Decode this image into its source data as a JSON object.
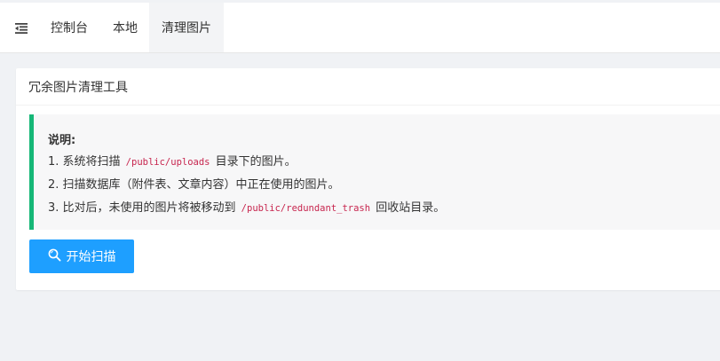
{
  "nav": {
    "toggle_icon": "menu-fold-icon",
    "tabs": [
      {
        "label": "控制台",
        "active": false
      },
      {
        "label": "本地",
        "active": false
      },
      {
        "label": "清理图片",
        "active": true
      }
    ]
  },
  "card": {
    "title": "冗余图片清理工具",
    "notice": {
      "title": "说明:",
      "line1_pre": "1. 系统将扫描 ",
      "line1_code": "/public/uploads",
      "line1_post": " 目录下的图片。",
      "line2": "2. 扫描数据库（附件表、文章内容）中正在使用的图片。",
      "line3_pre": "3. 比对后，未使用的图片将被移动到 ",
      "line3_code": "/public/redundant_trash",
      "line3_post": " 回收站目录。"
    },
    "scan_button": {
      "label": "开始扫描",
      "icon": "search-icon"
    }
  },
  "colors": {
    "accent": "#1e9fff",
    "notice_border": "#16b777",
    "code_text": "#c7254e"
  }
}
